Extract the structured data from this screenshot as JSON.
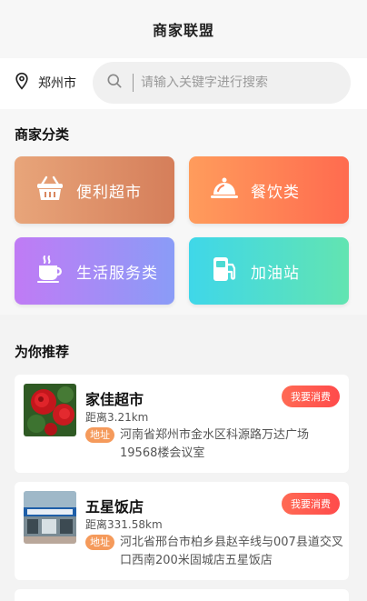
{
  "header": {
    "title": "商家联盟"
  },
  "location": {
    "city": "郑州市"
  },
  "search": {
    "placeholder": "请输入关键字进行搜索"
  },
  "categories": {
    "title": "商家分类",
    "items": [
      {
        "label": "便利超市",
        "icon": "basket-icon"
      },
      {
        "label": "餐饮类",
        "icon": "cloche-icon"
      },
      {
        "label": "生活服务类",
        "icon": "cup-icon"
      },
      {
        "label": "加油站",
        "icon": "fuel-pump-icon"
      }
    ]
  },
  "recommend": {
    "title": "为你推荐",
    "items": [
      {
        "name": "家佳超市",
        "distance": "距离3.21km",
        "address_tag": "地址",
        "address": "河南省郑州市金水区科源路万达广场19568楼会议室",
        "button": "我要消费"
      },
      {
        "name": "五星饭店",
        "distance": "距离331.58km",
        "address_tag": "地址",
        "address": "河北省邢台市柏乡县赵辛线与007县道交叉口西南200米固城店五星饭店",
        "button": "我要消费"
      }
    ]
  }
}
